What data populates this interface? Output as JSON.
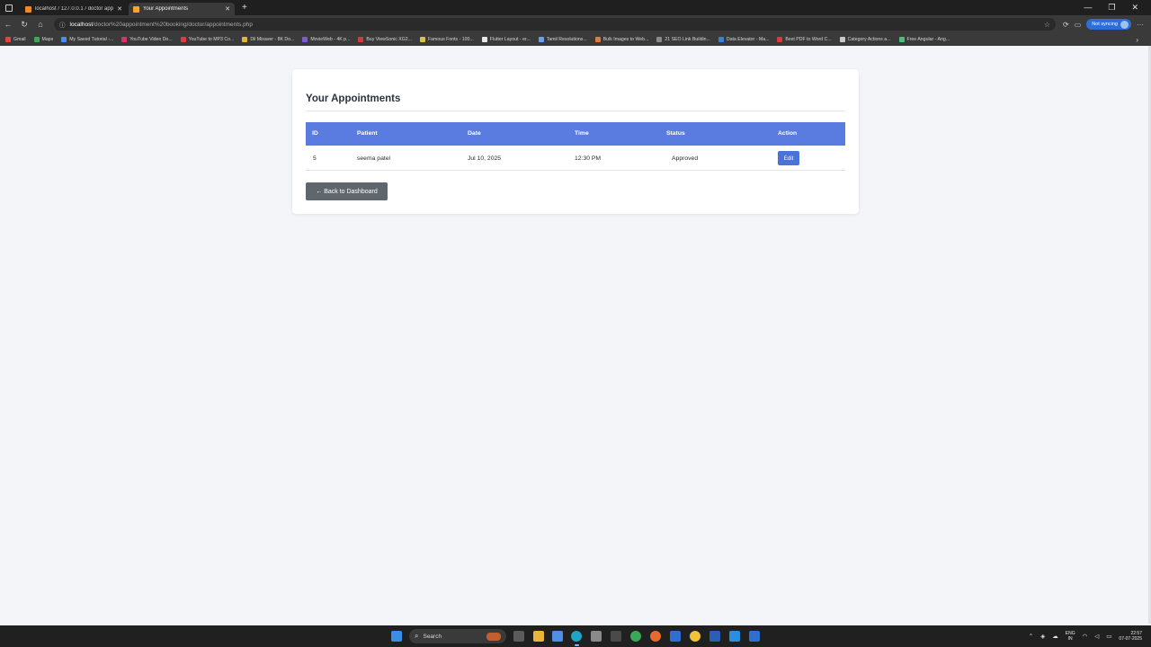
{
  "browser": {
    "tabs": [
      {
        "title": "localhost / 127.0.0.1 / doctor app",
        "active": false,
        "icon": "phpmyadmin-icon",
        "color": "#f08a24"
      },
      {
        "title": "Your Appointments",
        "active": true,
        "icon": "page-icon",
        "color": "#f2a33a"
      }
    ],
    "new_tab_glyph": "+",
    "url": {
      "host": "localhost",
      "path": "/doctor%20appointment%20booking/doctor/appointments.php"
    },
    "profile_label": "Not syncing",
    "bookmarks": [
      {
        "label": "Gmail",
        "color": "#e2463a"
      },
      {
        "label": "Maps",
        "color": "#3aa856"
      },
      {
        "label": "My Saved Tutorial -...",
        "color": "#4a8df0"
      },
      {
        "label": "YouTube Video Do...",
        "color": "#d6336c"
      },
      {
        "label": "YouTube to MP3 Co...",
        "color": "#e23b3b"
      },
      {
        "label": "Dil Mixaver - 8K Do...",
        "color": "#e0b43a"
      },
      {
        "label": "MovieWeb - 4K p...",
        "color": "#7b5cd6"
      },
      {
        "label": "Buy ViewSonic XG2...",
        "color": "#cf3b3b"
      },
      {
        "label": "Famous Fonts - 100...",
        "color": "#d9c14a"
      },
      {
        "label": "Flutter Layout - er...",
        "color": "#e8e8e8"
      },
      {
        "label": "Tamil Resolutions...",
        "color": "#6aa0f2"
      },
      {
        "label": "Bulk Images to Web...",
        "color": "#e07b3b"
      },
      {
        "label": "21 SEO Link Buildin...",
        "color": "#8a8a8a"
      },
      {
        "label": "Data Elevator - Ma...",
        "color": "#3a82d9"
      },
      {
        "label": "Best PDF to Word C...",
        "color": "#d93a3a"
      },
      {
        "label": "Category Actions a...",
        "color": "#c9c9c9"
      },
      {
        "label": "Free Angular - Ang...",
        "color": "#47c07a"
      }
    ],
    "bookmarks_more_glyph": "›"
  },
  "page": {
    "title": "Your Appointments",
    "table": {
      "columns": [
        "ID",
        "Patient",
        "Date",
        "Time",
        "Status",
        "Action"
      ],
      "rows": [
        {
          "id": "5",
          "patient": "seema patel",
          "date": "Jul 10, 2025",
          "time": "12:30 PM",
          "status": "Approved",
          "action": "Edit"
        }
      ]
    },
    "back_button": "← Back to Dashboard"
  },
  "taskbar": {
    "search_placeholder": "Search",
    "lang": [
      "ENG",
      "IN"
    ],
    "time": "22:57",
    "date": "07-07-2025"
  },
  "colors": {
    "table_header": "#5a7be0",
    "edit_button": "#4a72d9",
    "back_button": "#5f666e"
  }
}
